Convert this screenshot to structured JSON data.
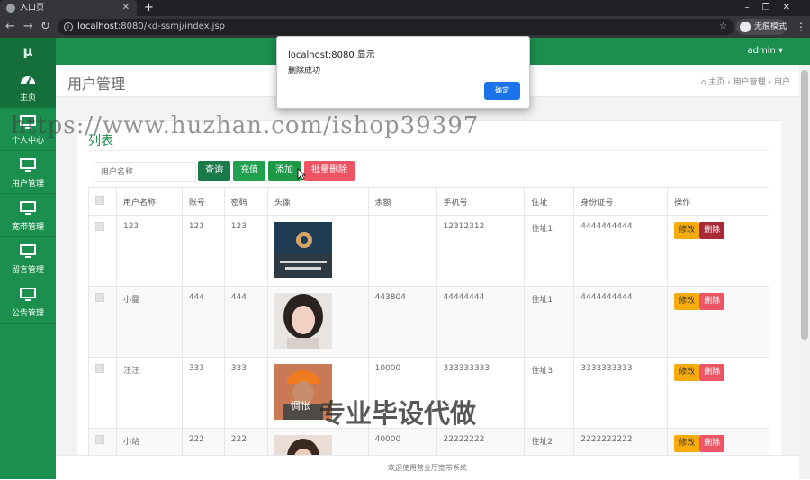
{
  "browser": {
    "tab_title": "入口页",
    "url_host": "localhost",
    "url_rest": ":8080/kd-ssmj/index.jsp",
    "incognito_label": "无痕模式"
  },
  "app": {
    "brand": "μ",
    "user_menu": "admin ▾",
    "accent": "#1b8f4d"
  },
  "sidebar": {
    "items": [
      {
        "label": "主页",
        "icon": "dashboard-icon"
      },
      {
        "label": "个人中心",
        "icon": "monitor-icon"
      },
      {
        "label": "用户管理",
        "icon": "monitor-icon"
      },
      {
        "label": "宽带管理",
        "icon": "monitor-icon"
      },
      {
        "label": "留言管理",
        "icon": "monitor-icon"
      },
      {
        "label": "公告管理",
        "icon": "monitor-icon"
      }
    ]
  },
  "page": {
    "title": "用户管理",
    "breadcrumb": [
      "主页",
      "用户管理",
      "用户"
    ]
  },
  "panel": {
    "title": "列表",
    "search_placeholder": "用户名称",
    "buttons": {
      "query": "查询",
      "charge": "充值",
      "add": "添加",
      "batch_delete": "批量删除"
    }
  },
  "table": {
    "headers": [
      "用户名称",
      "账号",
      "密码",
      "头像",
      "余额",
      "手机号",
      "住址",
      "身份证号",
      "操作"
    ],
    "rows": [
      {
        "name": "123",
        "account": "123",
        "password": "123",
        "balance": "",
        "phone": "12312312",
        "address": "住址1",
        "idcard": "4444444444"
      },
      {
        "name": "小曼",
        "account": "444",
        "password": "444",
        "balance": "443804",
        "phone": "44444444",
        "address": "住址1",
        "idcard": "4444444444"
      },
      {
        "name": "汪汪",
        "account": "333",
        "password": "333",
        "balance": "10000",
        "phone": "333333333",
        "address": "住址3",
        "idcard": "3333333333"
      },
      {
        "name": "小站",
        "account": "222",
        "password": "222",
        "balance": "40000",
        "phone": "22222222",
        "address": "住址2",
        "idcard": "2222222222"
      }
    ],
    "actions": {
      "edit": "修改",
      "delete": "删除"
    }
  },
  "footer": {
    "text": "欢迎使用营业厅宽带系统"
  },
  "alert": {
    "heading": "localhost:8080 显示",
    "message": "删除成功",
    "ok": "确定"
  },
  "watermarks": {
    "url": "https://www.huzhan.com/ishop39397",
    "slogan": "专业毕设代做",
    "image_caption": "惆怅"
  }
}
